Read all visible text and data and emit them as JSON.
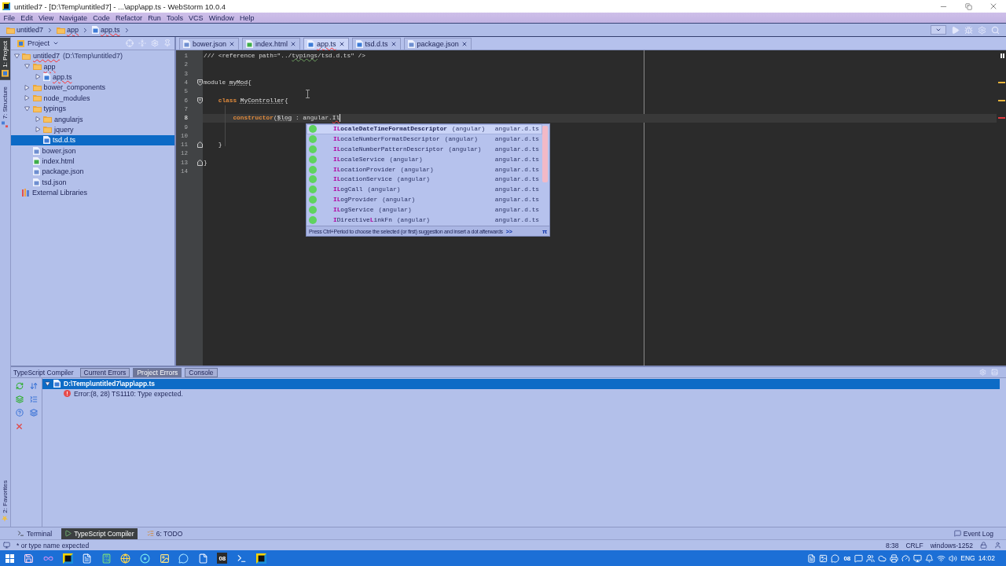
{
  "window": {
    "title": "untitled7 - [D:\\Temp\\untitled7] - ...\\app\\app.ts - WebStorm 10.0.4"
  },
  "menu": [
    "File",
    "Edit",
    "View",
    "Navigate",
    "Code",
    "Refactor",
    "Run",
    "Tools",
    "VCS",
    "Window",
    "Help"
  ],
  "breadcrumbs": [
    {
      "label": "untitled7",
      "kind": "folder",
      "error": false
    },
    {
      "label": "app",
      "kind": "folder",
      "error": true
    },
    {
      "label": "app.ts",
      "kind": "ts",
      "error": true
    }
  ],
  "side_stripe": {
    "top": [
      {
        "label": "1: Project",
        "selected": true
      },
      {
        "label": "7: Structure",
        "selected": false
      }
    ],
    "bottom": [
      {
        "label": "2: Favorites",
        "selected": false
      }
    ]
  },
  "project_panel": {
    "title": "Project",
    "tree": [
      {
        "label": "untitled7",
        "detail": "(D:\\Temp\\untitled7)",
        "kind": "folder",
        "expanded": true,
        "selected": false,
        "error": true,
        "children": [
          {
            "label": "app",
            "kind": "folder",
            "expanded": true,
            "selected": false,
            "error": true,
            "children": [
              {
                "label": "app.ts",
                "kind": "ts",
                "expanded": false,
                "selected": false,
                "error": true
              }
            ]
          },
          {
            "label": "bower_components",
            "kind": "folder",
            "expanded": false,
            "selected": false,
            "error": false
          },
          {
            "label": "node_modules",
            "kind": "folder",
            "expanded": false,
            "selected": false,
            "error": false
          },
          {
            "label": "typings",
            "kind": "folder",
            "expanded": true,
            "selected": false,
            "error": false,
            "children": [
              {
                "label": "angularjs",
                "kind": "folder",
                "expanded": false,
                "selected": false,
                "error": false
              },
              {
                "label": "jquery",
                "kind": "folder",
                "expanded": false,
                "selected": false,
                "error": false
              },
              {
                "label": "tsd.d.ts",
                "kind": "ts",
                "selected": true,
                "error": false
              }
            ]
          },
          {
            "label": "bower.json",
            "kind": "json",
            "selected": false,
            "error": false
          },
          {
            "label": "index.html",
            "kind": "html",
            "selected": false,
            "error": false
          },
          {
            "label": "package.json",
            "kind": "json",
            "selected": false,
            "error": false
          },
          {
            "label": "tsd.json",
            "kind": "json",
            "selected": false,
            "error": false
          }
        ]
      },
      {
        "label": "External Libraries",
        "kind": "library",
        "selected": false,
        "error": false
      }
    ]
  },
  "editor": {
    "tabs": [
      {
        "label": "bower.json",
        "kind": "json",
        "selected": false,
        "error": false
      },
      {
        "label": "index.html",
        "kind": "html",
        "selected": false,
        "error": false
      },
      {
        "label": "app.ts",
        "kind": "ts",
        "selected": true,
        "error": true
      },
      {
        "label": "tsd.d.ts",
        "kind": "ts",
        "selected": false,
        "error": false
      },
      {
        "label": "package.json",
        "kind": "json",
        "selected": false,
        "error": false
      }
    ],
    "lines": [
      {
        "number": "1",
        "kind": "plain",
        "current": false,
        "tokens": [
          {
            "text": "/// <reference path=\"../",
            "kind": "text"
          },
          {
            "text": "typings",
            "kind": "typo"
          },
          {
            "text": "/tsd.d.ts\" />",
            "kind": "text"
          }
        ]
      },
      {
        "number": "2",
        "kind": "plain",
        "current": false
      },
      {
        "number": "3",
        "kind": "plain",
        "current": false
      },
      {
        "number": "4",
        "kind": "opener",
        "current": false,
        "tokens": [
          {
            "text": "module ",
            "kind": "text"
          },
          {
            "text": "myMod",
            "kind": "underlined"
          },
          {
            "text": "{",
            "kind": "text"
          }
        ]
      },
      {
        "number": "5",
        "kind": "plain",
        "current": false
      },
      {
        "number": "6",
        "kind": "opener",
        "current": false,
        "tokens": [
          {
            "text": "    class ",
            "kind": "keyword"
          },
          {
            "text": "MyController",
            "kind": "underlined"
          },
          {
            "text": "{",
            "kind": "text"
          }
        ]
      },
      {
        "number": "7",
        "kind": "plain",
        "current": false
      },
      {
        "number": "8",
        "kind": "plain",
        "current": true,
        "tokens": [
          {
            "text": "        constructor",
            "kind": "keyword"
          },
          {
            "text": "(",
            "kind": "text"
          },
          {
            "text": "$log",
            "kind": "underlined"
          },
          {
            "text": " : angular.",
            "kind": "text"
          },
          {
            "text": "Il",
            "kind": "error"
          }
        ]
      },
      {
        "number": "9",
        "kind": "plain",
        "current": false
      },
      {
        "number": "10",
        "kind": "plain",
        "current": false
      },
      {
        "number": "11",
        "kind": "closer",
        "current": false,
        "tokens": [
          {
            "text": "    }",
            "kind": "text"
          }
        ]
      },
      {
        "number": "12",
        "kind": "plain",
        "current": false
      },
      {
        "number": "13",
        "kind": "closer",
        "current": false,
        "tokens": [
          {
            "text": "}",
            "kind": "text"
          }
        ]
      },
      {
        "number": "14",
        "kind": "plain",
        "current": false
      }
    ],
    "completion": {
      "items": [
        {
          "name": "**IL**ocaleDateTimeFormatDescriptor",
          "module": "(angular)",
          "file": "angular.d.ts",
          "selected": true
        },
        {
          "name": "**IL**ocaleNumberFormatDescriptor",
          "module": "(angular)",
          "file": "angular.d.ts",
          "selected": false
        },
        {
          "name": "**IL**ocaleNumberPatternDescriptor",
          "module": "(angular)",
          "file": "angular.d.ts",
          "selected": false
        },
        {
          "name": "**IL**ocaleService",
          "module": "(angular)",
          "file": "angular.d.ts",
          "selected": false
        },
        {
          "name": "**IL**ocationProvider",
          "module": "(angular)",
          "file": "angular.d.ts",
          "selected": false
        },
        {
          "name": "**IL**ocationService",
          "module": "(angular)",
          "file": "angular.d.ts",
          "selected": false
        },
        {
          "name": "**IL**ogCall",
          "module": "(angular)",
          "file": "angular.d.ts",
          "selected": false
        },
        {
          "name": "**IL**ogProvider",
          "module": "(angular)",
          "file": "angular.d.ts",
          "selected": false
        },
        {
          "name": "**IL**ogService",
          "module": "(angular)",
          "file": "angular.d.ts",
          "selected": false
        },
        {
          "name": "**I**Directive**L**inkFn",
          "module": "(angular)",
          "file": "angular.d.ts",
          "selected": false
        }
      ],
      "hint": "Press Ctrl+Period to choose the selected (or first) suggestion and insert a dot afterwards",
      "hint_link": ">>",
      "corner_glyph": "π"
    }
  },
  "tool_window": {
    "title": "TypeScript Compiler",
    "tabs": [
      {
        "label": "Current Errors",
        "selected": false
      },
      {
        "label": "Project Errors",
        "selected": true
      },
      {
        "label": "Console",
        "selected": false
      }
    ],
    "tree": [
      {
        "label": "D:\\Temp\\untitled7\\app\\app.ts",
        "expanded": true,
        "selected": true,
        "children": [
          {
            "label": "Error:(8, 28) TS1110: Type expected.",
            "selected": false
          }
        ]
      }
    ]
  },
  "tool_stripe": {
    "buttons": [
      {
        "label": "Terminal",
        "kind": "terminal",
        "selected": false
      },
      {
        "label": "TypeScript Compiler",
        "kind": "compiler",
        "selected": true
      },
      {
        "label": "6: TODO",
        "kind": "todo",
        "selected": false
      }
    ],
    "event_log": "Event Log"
  },
  "status_bar": {
    "message": "* or type name expected",
    "position": "8:38",
    "line_separator": "CRLF",
    "encoding": "windows-1252"
  },
  "taskbar": {
    "app_badge": "08",
    "tray_badge": "08",
    "language": "ENG",
    "clock": "14:02"
  }
}
